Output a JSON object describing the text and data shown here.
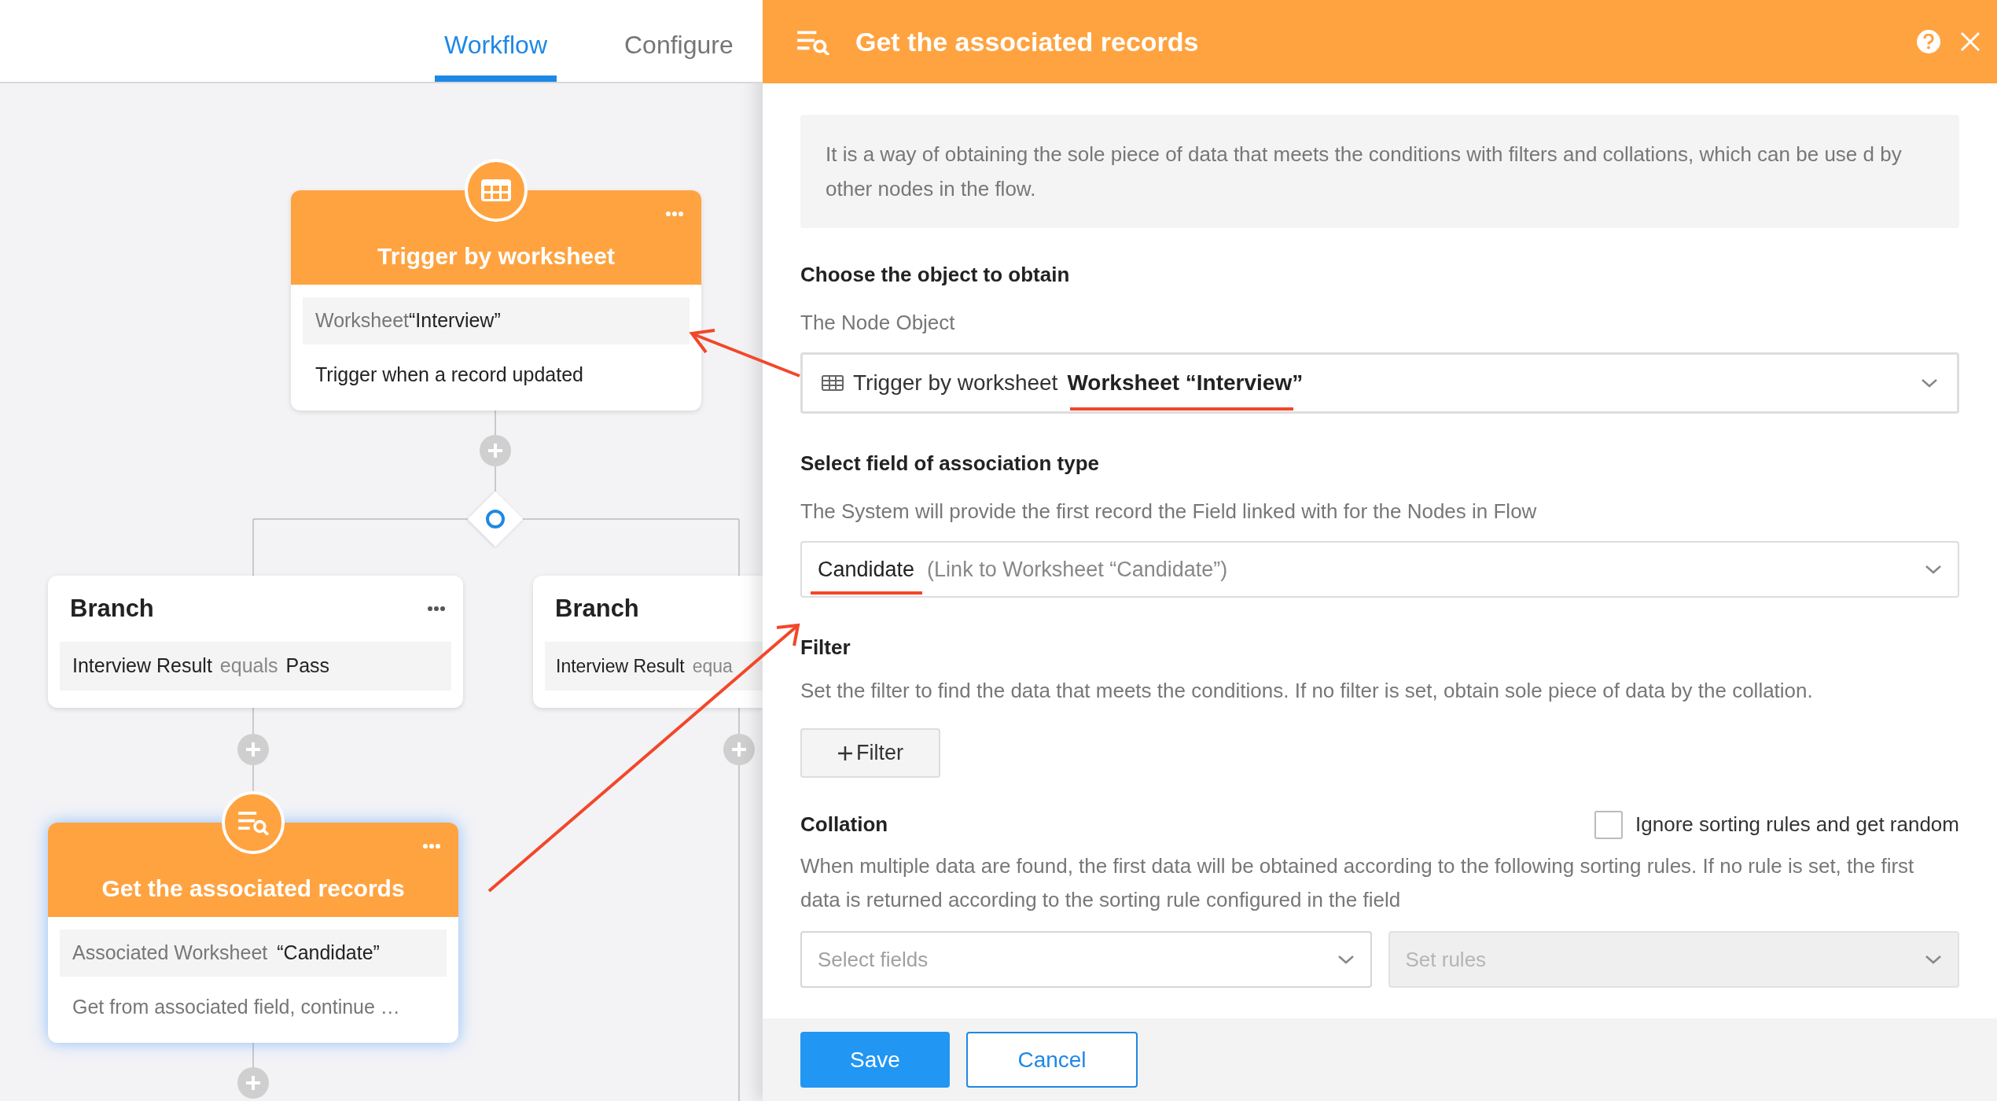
{
  "tabs": [
    {
      "label": "Workflow",
      "selected": true
    },
    {
      "label": "Configure",
      "selected": false
    }
  ],
  "flow": {
    "trigger_node": {
      "title": "Trigger by worksheet",
      "detail_label": "Worksheet",
      "detail_value": "“Interview”",
      "description": "Trigger when a record updated"
    },
    "branches": [
      {
        "title": "Branch",
        "field": "Interview Result",
        "operator": "equals",
        "value": "Pass"
      },
      {
        "title": "Branch",
        "field": "Interview Result",
        "operator": "equa"
      }
    ],
    "action_node": {
      "title": "Get the associated records",
      "detail_label": "Associated Worksheet",
      "detail_value": "“Candidate”",
      "description": "Get from associated field, continue …",
      "selected": true
    }
  },
  "panel": {
    "title": "Get the associated records",
    "description": "It is a way of obtaining the sole piece of data that meets the conditions with filters and collations, which can be use d by other nodes in the flow.",
    "object_section": {
      "heading": "Choose the object to obtain",
      "label": "The Node Object",
      "select": {
        "node": "Trigger by worksheet",
        "value": "Worksheet “Interview”"
      }
    },
    "field_section": {
      "heading": "Select field of association type",
      "hint": "The System will provide the first record the Field linked with for the Nodes in Flow",
      "select": {
        "value": "Candidate",
        "detail": "(Link to Worksheet “Candidate”)"
      }
    },
    "filter_section": {
      "heading": "Filter",
      "hint": "Set the filter to find the data that meets the conditions. If no filter is set, obtain sole piece of data by the collation.",
      "button": "Filter"
    },
    "collation_section": {
      "heading": "Collation",
      "checkbox": {
        "label": "Ignore sorting rules and get random",
        "checked": false
      },
      "hint": "When multiple data are found, the first data will be obtained according to the following sorting rules. If no rule is set, the first data is returned according to the sorting rule configured in the field",
      "selects": [
        {
          "placeholder": "Select fields",
          "disabled": false
        },
        {
          "placeholder": "Set rules",
          "disabled": true
        }
      ]
    },
    "buttons": [
      {
        "label": "Save",
        "kind": "primary"
      },
      {
        "label": "Cancel",
        "kind": "secondary"
      }
    ]
  }
}
